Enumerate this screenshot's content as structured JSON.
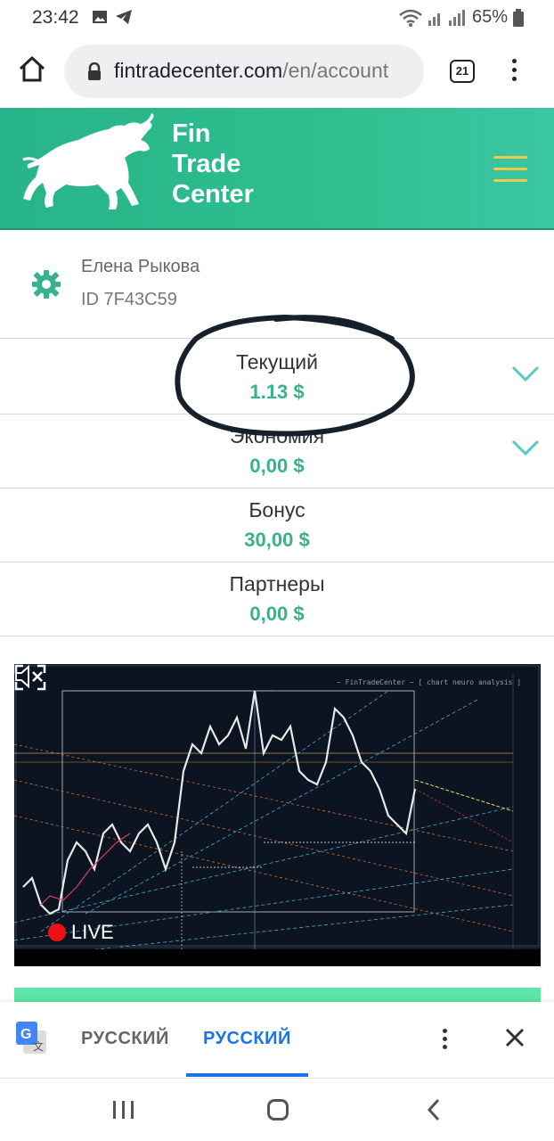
{
  "status_bar": {
    "time": "23:42",
    "battery": "65%",
    "icons": [
      "image-icon",
      "telegram-icon",
      "wifi-icon",
      "signal-icon",
      "battery-icon"
    ]
  },
  "browser": {
    "url_domain": "fintradecenter.com",
    "url_path": "/en/account",
    "tab_count": "21"
  },
  "header": {
    "brand_line1": "Fin",
    "brand_line2": "Trade",
    "brand_line3": "Center",
    "accent_color": "#f0c84a",
    "brand_color": "#2fbf8d"
  },
  "user": {
    "name": "Елена Рыкова",
    "id": "ID 7F43C59"
  },
  "balances": [
    {
      "label": "Текущий",
      "value": "1.13 $"
    },
    {
      "label": "Экономия",
      "value": "0,00 $"
    },
    {
      "label": "Бонус",
      "value": "30,00 $"
    },
    {
      "label": "Партнеры",
      "value": "0,00 $"
    }
  ],
  "chart": {
    "live_label": "LIVE",
    "watermark": "~ FinTradeCenter ~ [ chart neuro analysis ]"
  },
  "translate_bar": {
    "from_lang": "РУССКИЙ",
    "to_lang": "РУССКИЙ",
    "active_color": "#1a73e8"
  }
}
